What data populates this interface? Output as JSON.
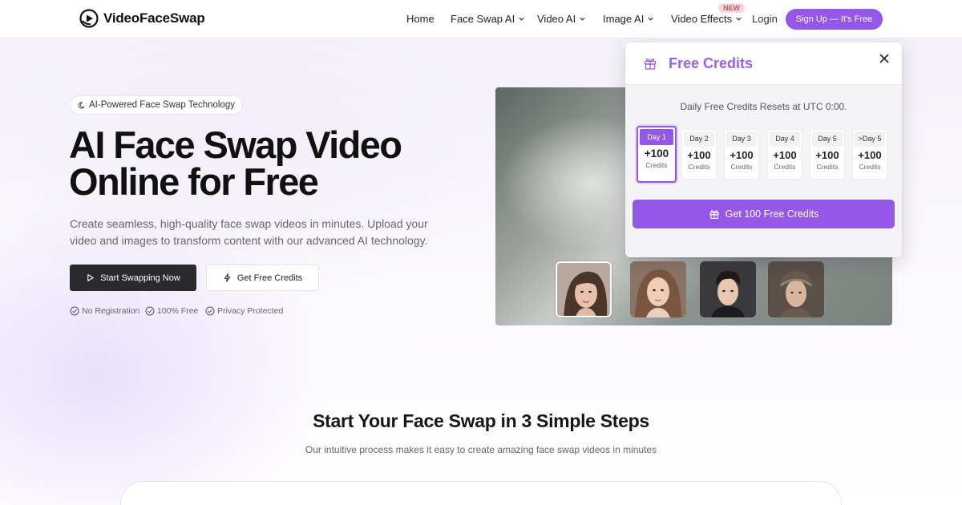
{
  "header": {
    "brand": "VideoFaceSwap",
    "nav": [
      {
        "label": "Home",
        "has_dropdown": false
      },
      {
        "label": "Face Swap AI",
        "has_dropdown": true
      },
      {
        "label": "Video AI",
        "has_dropdown": true
      },
      {
        "label": "Image AI",
        "has_dropdown": true
      },
      {
        "label": "Video Effects",
        "has_dropdown": true,
        "badge": "NEW"
      }
    ],
    "login": "Login",
    "signup": "Sign Up — It's Free"
  },
  "hero": {
    "pill": "AI-Powered Face Swap Technology",
    "title_line1": "AI Face Swap Video",
    "title_line2": "Online for Free",
    "lead": "Create seamless, high-quality face swap videos in minutes. Upload your video and images to transform content with our advanced AI technology.",
    "primary_button": "Start Swapping Now",
    "secondary_button": "Get Free Credits",
    "checks": [
      "No Registration",
      "100% Free",
      "Privacy Protected"
    ]
  },
  "face_thumbnails": [
    {
      "icon": "face-woman-1",
      "selected": true
    },
    {
      "icon": "face-woman-2",
      "selected": false
    },
    {
      "icon": "face-man",
      "selected": false
    },
    {
      "icon": "face-woman-3",
      "selected": false
    }
  ],
  "popup": {
    "title": "Free Credits",
    "subtitle": "Daily Free Credits Resets at UTC 0:00.",
    "days": [
      {
        "label": "Day 1",
        "value": "+100",
        "unit": "Credits",
        "active": true
      },
      {
        "label": "Day 2",
        "value": "+100",
        "unit": "Credits",
        "active": false
      },
      {
        "label": "Day 3",
        "value": "+100",
        "unit": "Credits",
        "active": false
      },
      {
        "label": "Day 4",
        "value": "+100",
        "unit": "Credits",
        "active": false
      },
      {
        "label": "Day 5",
        "value": "+100",
        "unit": "Credits",
        "active": false
      },
      {
        "label": ">Day 5",
        "value": "+100",
        "unit": "Credits",
        "active": false
      }
    ],
    "button": "Get 100 Free Credits"
  },
  "steps": {
    "title": "Start Your Face Swap in 3 Simple Steps",
    "subtitle": "Our intuitive process makes it easy to create amazing face swap videos in minutes"
  },
  "colors": {
    "accent": "#9457e8",
    "dark_button": "#2a2a2e",
    "badge_text": "#e04b5e",
    "badge_bg": "#f5d9dd"
  }
}
